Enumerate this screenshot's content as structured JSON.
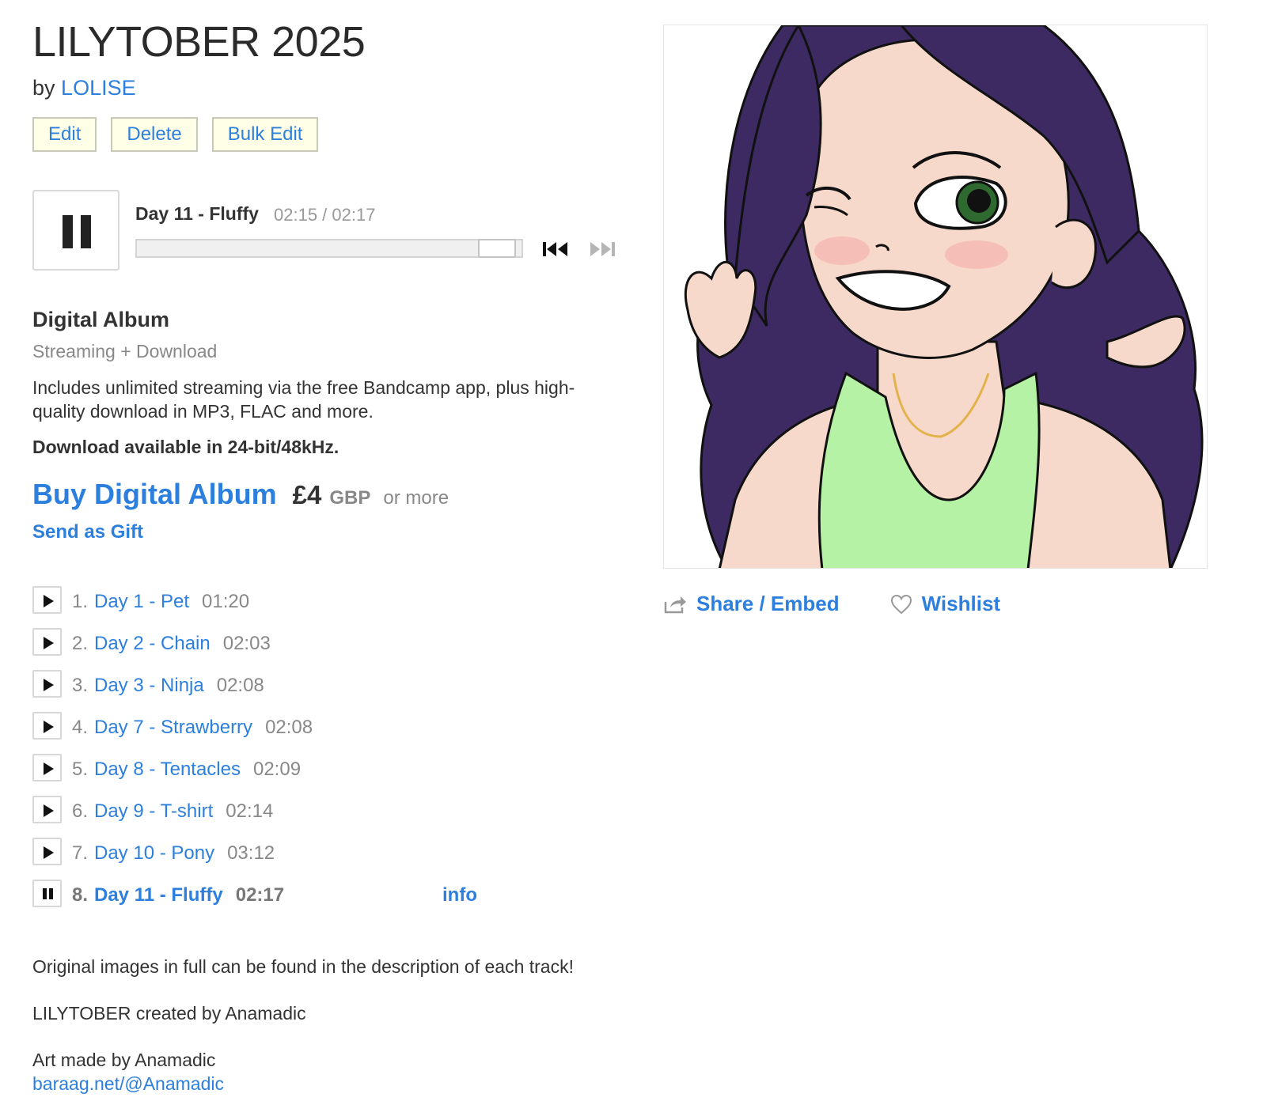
{
  "album": {
    "title": "LILYTOBER 2025",
    "by_prefix": "by",
    "artist": "LOLISE"
  },
  "admin": {
    "edit": "Edit",
    "delete": "Delete",
    "bulk_edit": "Bulk Edit"
  },
  "player": {
    "state": "playing",
    "track_title": "Day 11 - Fluffy",
    "time": "02:15 / 02:17",
    "progress_fraction": 0.985
  },
  "purchase": {
    "type": "Digital Album",
    "subtype": "Streaming + Download",
    "description": "Includes unlimited streaming via the free Bandcamp app, plus high-quality download in MP3, FLAC and more.",
    "bitrate_note": "Download available in 24-bit/48kHz.",
    "buy_label": "Buy Digital Album",
    "price": "£4",
    "currency": "GBP",
    "or_more": "or more",
    "gift_label": "Send as Gift"
  },
  "tracks": [
    {
      "num": "1.",
      "name": "Day 1 - Pet",
      "time": "01:20"
    },
    {
      "num": "2.",
      "name": "Day 2 - Chain",
      "time": "02:03"
    },
    {
      "num": "3.",
      "name": "Day 3 - Ninja",
      "time": "02:08"
    },
    {
      "num": "4.",
      "name": "Day 7 - Strawberry",
      "time": "02:08"
    },
    {
      "num": "5.",
      "name": "Day 8 - Tentacles",
      "time": "02:09"
    },
    {
      "num": "6.",
      "name": "Day 9 - T-shirt",
      "time": "02:14"
    },
    {
      "num": "7.",
      "name": "Day 10 - Pony",
      "time": "03:12"
    },
    {
      "num": "8.",
      "name": "Day 11 - Fluffy",
      "time": "02:17",
      "info": "info"
    }
  ],
  "about": {
    "line1": "Original images in full can be found in the description of each track!",
    "line2": "LILYTOBER created by Anamadic",
    "line3": "Art made by Anamadic",
    "link": "baraag.net/@Anamadic"
  },
  "actions": {
    "share": "Share / Embed",
    "wishlist": "Wishlist"
  },
  "colors": {
    "link": "#2c7fdd",
    "admin_button_bg": "#fffee6",
    "hair": "#3e2a62",
    "top": "#b6f2a6",
    "skin": "#f7d9cc"
  },
  "icons": [
    "pause-icon",
    "previous-track-icon",
    "next-track-icon",
    "play-icon",
    "share-icon",
    "heart-icon"
  ]
}
